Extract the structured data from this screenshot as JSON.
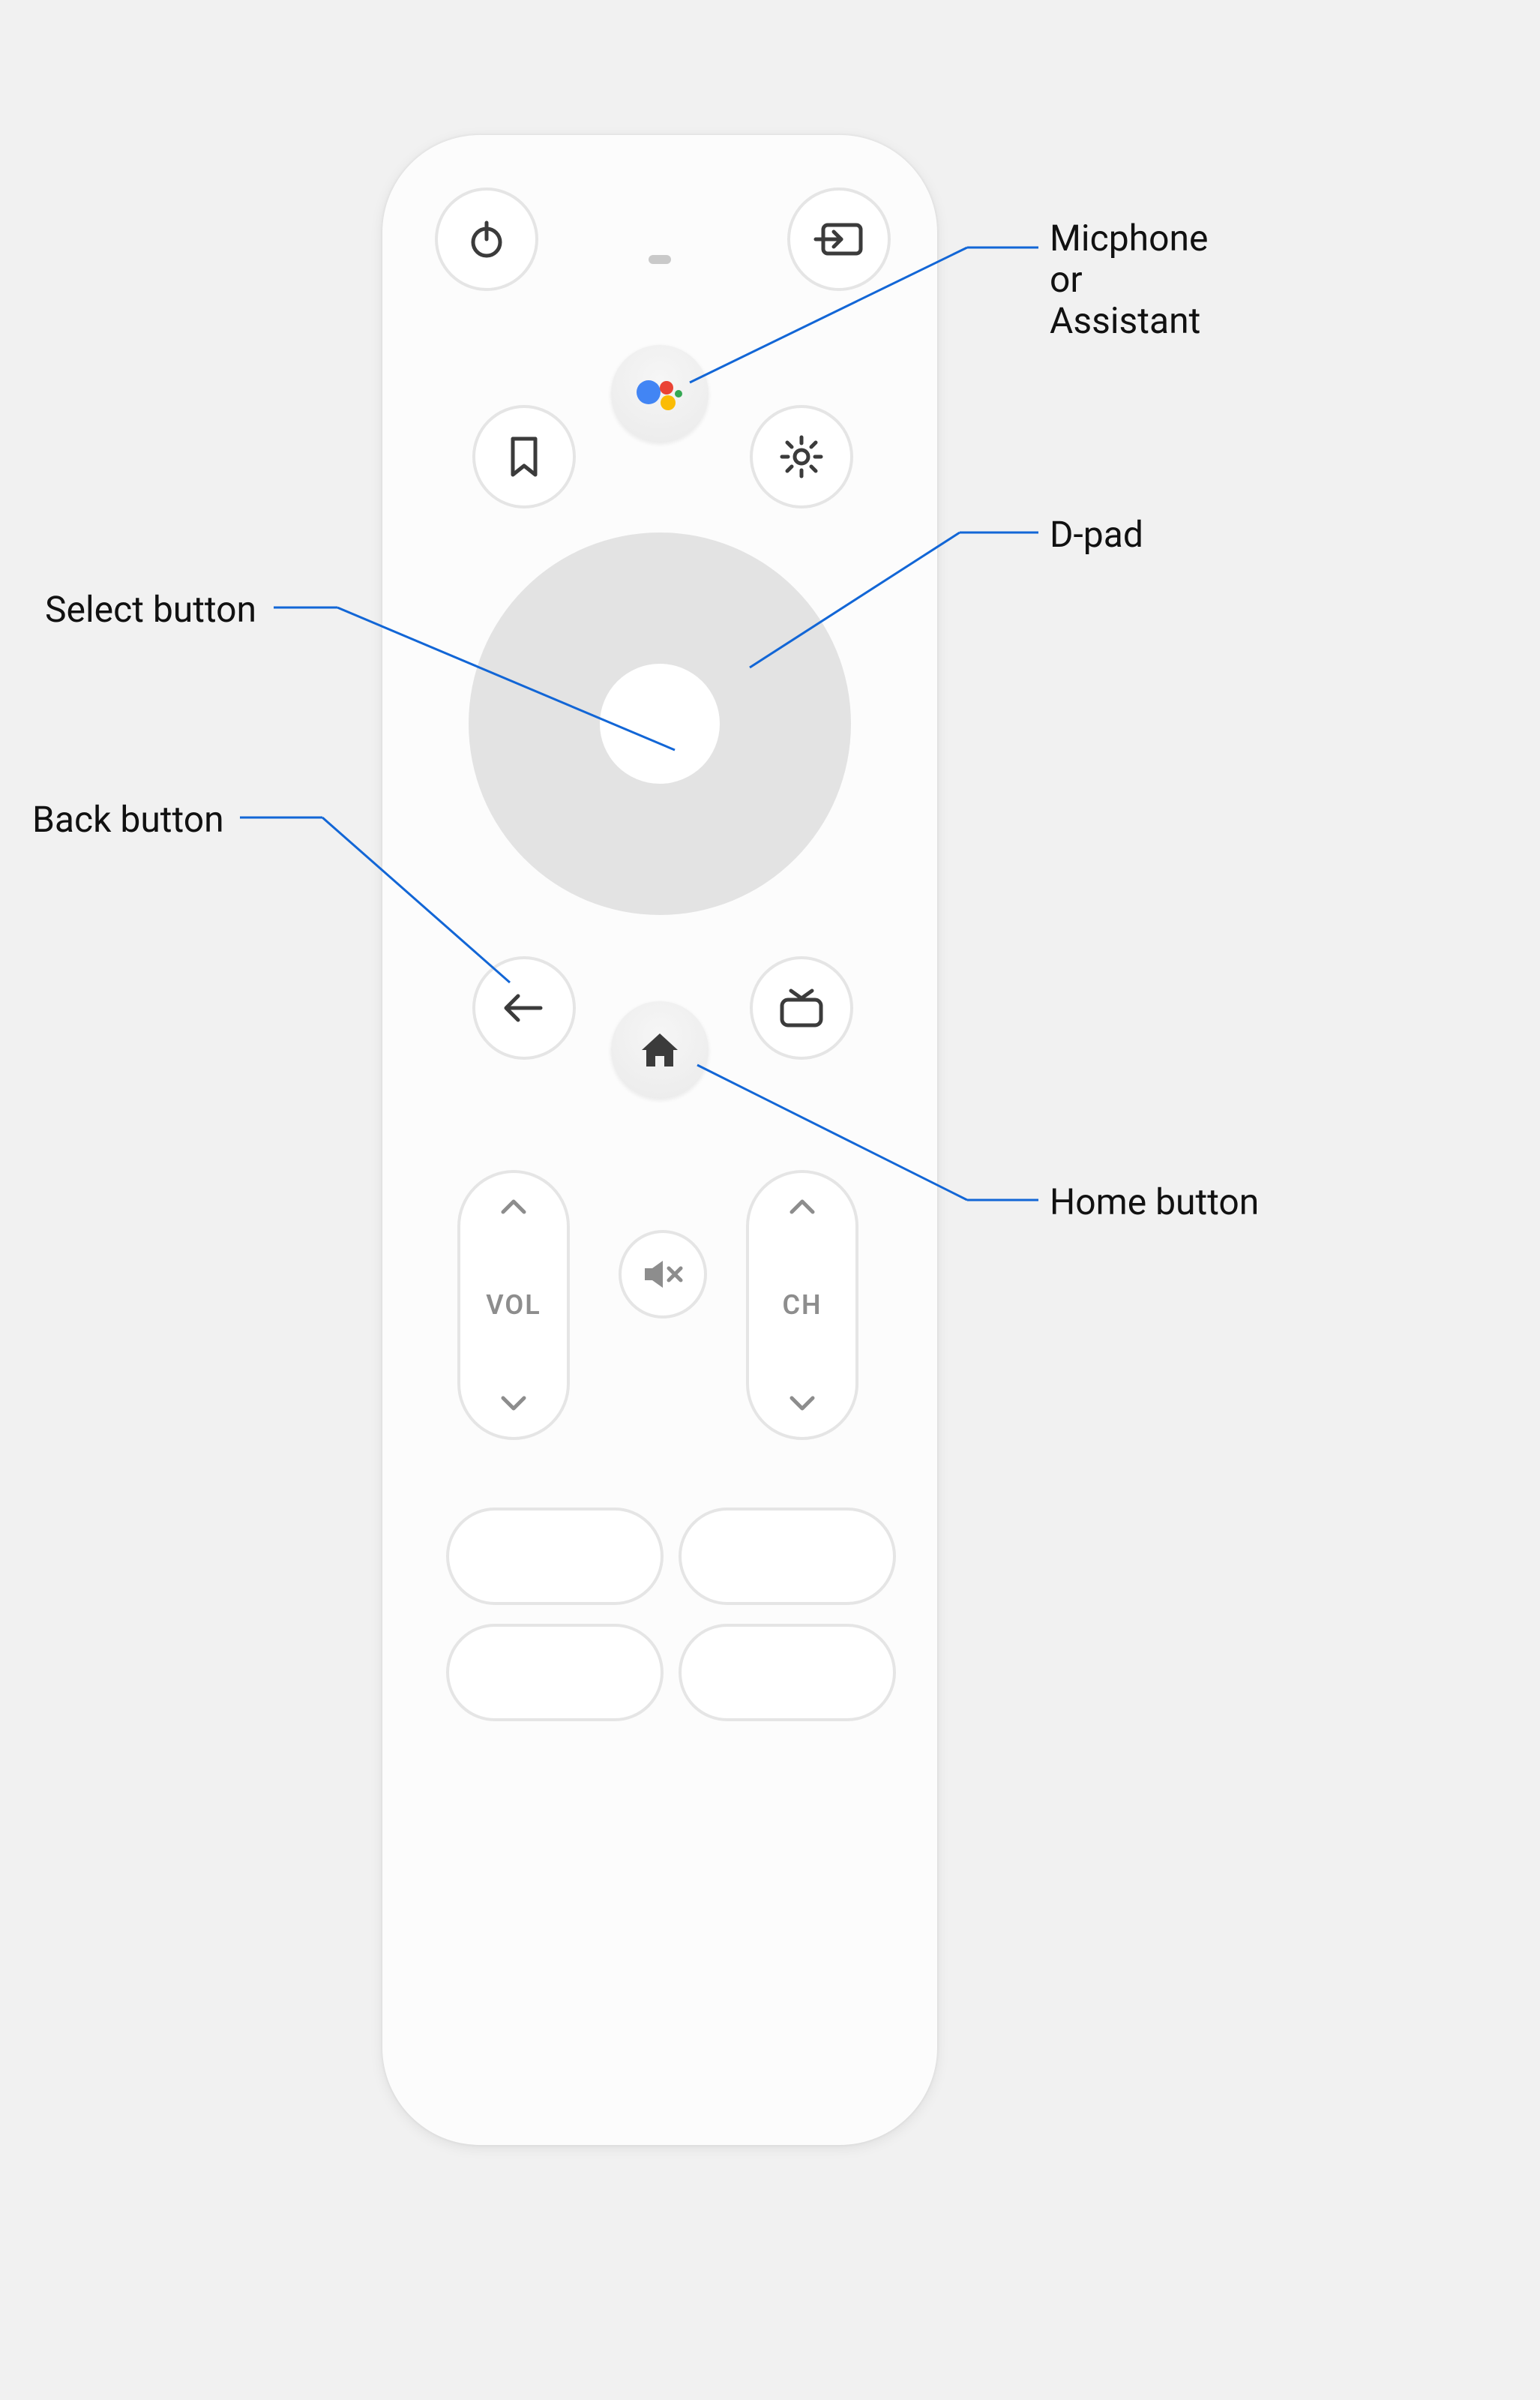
{
  "callouts": {
    "assistant": "Micphone\nor\nAssistant",
    "dpad": "D-pad",
    "home": "Home button",
    "select": "Select button",
    "back": "Back button"
  },
  "remote": {
    "vol_label": "VOL",
    "ch_label": "CH"
  },
  "colors": {
    "leader": "#1266d6",
    "remote_body": "#fcfcfc",
    "button_border": "#e5e5e5",
    "dpad": "#e3e3e3",
    "icon": "#3b3b3b",
    "assistant_blue": "#4285F4",
    "assistant_red": "#EA4335",
    "assistant_yellow": "#FBBC05",
    "assistant_green": "#34A853"
  }
}
